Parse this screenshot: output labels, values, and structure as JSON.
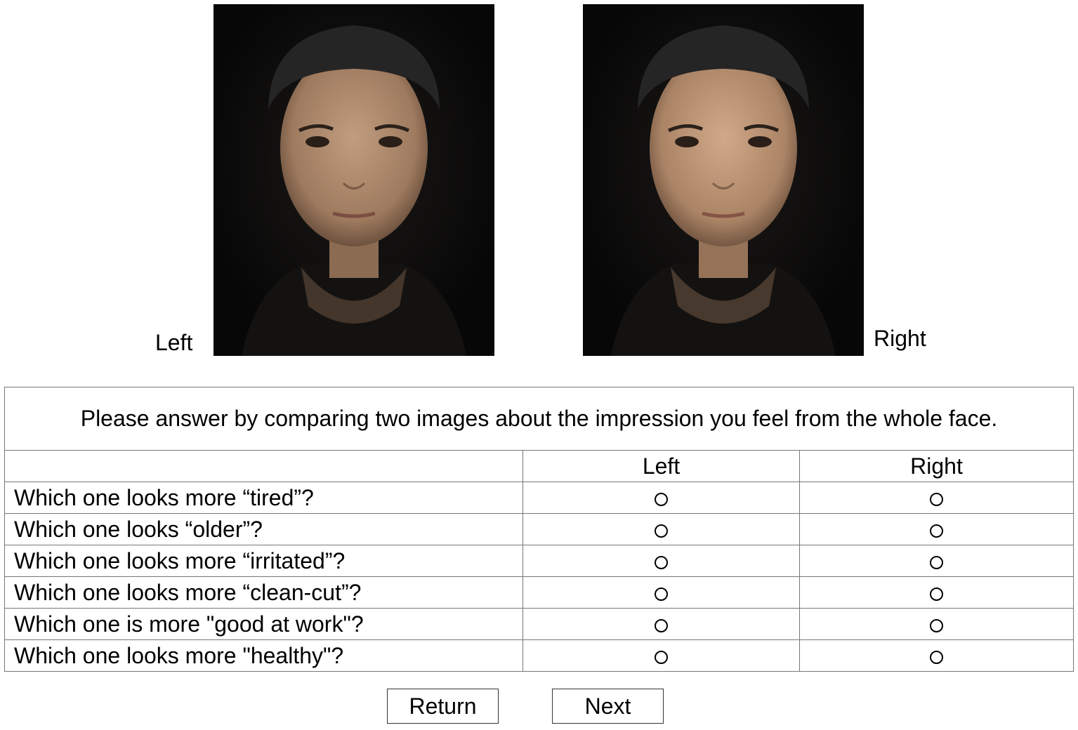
{
  "images": {
    "left_label": "Left",
    "right_label": "Right"
  },
  "survey": {
    "instruction": "Please answer by comparing two images about the impression you feel from the whole face.",
    "columns": [
      "",
      "Left",
      "Right"
    ],
    "questions": [
      "Which one looks more “tired”?",
      "Which one looks “older”?",
      "Which one looks more “irritated”?",
      "Which one looks more “clean-cut”?",
      "Which one is more \"good at work\"?",
      "Which one looks more \"healthy\"?"
    ]
  },
  "buttons": {
    "return_label": "Return",
    "next_label": "Next"
  },
  "colors": {
    "image_background": "#070707",
    "table_border": "#777777"
  }
}
